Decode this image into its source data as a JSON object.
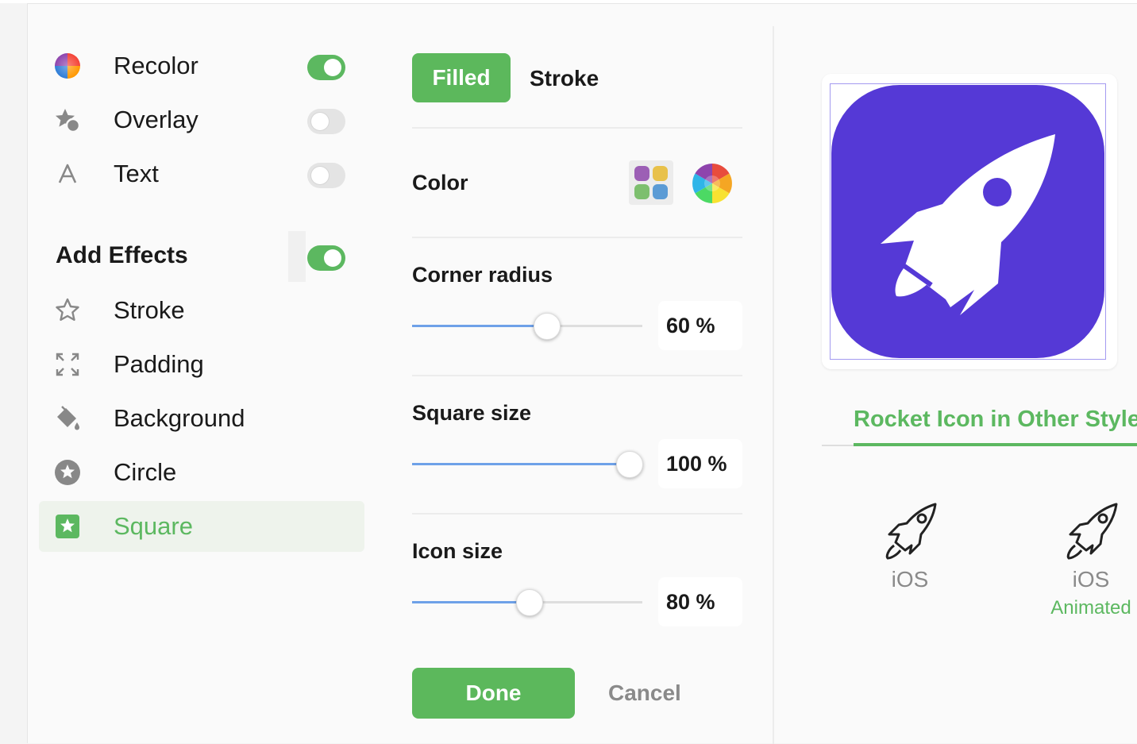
{
  "menu": {
    "items": [
      {
        "label": "Recolor",
        "icon": "color-wheel-icon",
        "toggle": "on"
      },
      {
        "label": "Overlay",
        "icon": "star-overlay-icon",
        "toggle": "off"
      },
      {
        "label": "Text",
        "icon": "text-icon",
        "toggle": "off"
      }
    ],
    "effects_title": "Add Effects",
    "effects_toggle": "on",
    "effects": [
      {
        "label": "Stroke",
        "icon": "star-outline-icon"
      },
      {
        "label": "Padding",
        "icon": "expand-arrows-icon"
      },
      {
        "label": "Background",
        "icon": "paint-bucket-icon"
      },
      {
        "label": "Circle",
        "icon": "star-circle-icon"
      },
      {
        "label": "Square",
        "icon": "star-square-icon",
        "selected": true
      }
    ]
  },
  "editor": {
    "tabs": [
      "Filled",
      "Stroke"
    ],
    "active_tab": "Filled",
    "color_label": "Color",
    "palette_colors": [
      "#9c5fb5",
      "#e8c14a",
      "#7dbf6e",
      "#5b9bd5"
    ],
    "corner_radius": {
      "label": "Corner radius",
      "value": 60,
      "display": "60 %"
    },
    "square_size": {
      "label": "Square size",
      "value": 100,
      "display": "100 %"
    },
    "icon_size": {
      "label": "Icon size",
      "value": 80,
      "display": "80 %"
    },
    "done_label": "Done",
    "cancel_label": "Cancel"
  },
  "preview": {
    "background_color": "#5539d6",
    "icon": "rocket-icon",
    "other_styles_title": "Rocket Icon in Other Styles",
    "styles": [
      {
        "label": "iOS",
        "sub": ""
      },
      {
        "label": "iOS",
        "sub": "Animated"
      }
    ]
  },
  "colors": {
    "accent": "#5cb85c",
    "slider": "#6ea1e8"
  }
}
